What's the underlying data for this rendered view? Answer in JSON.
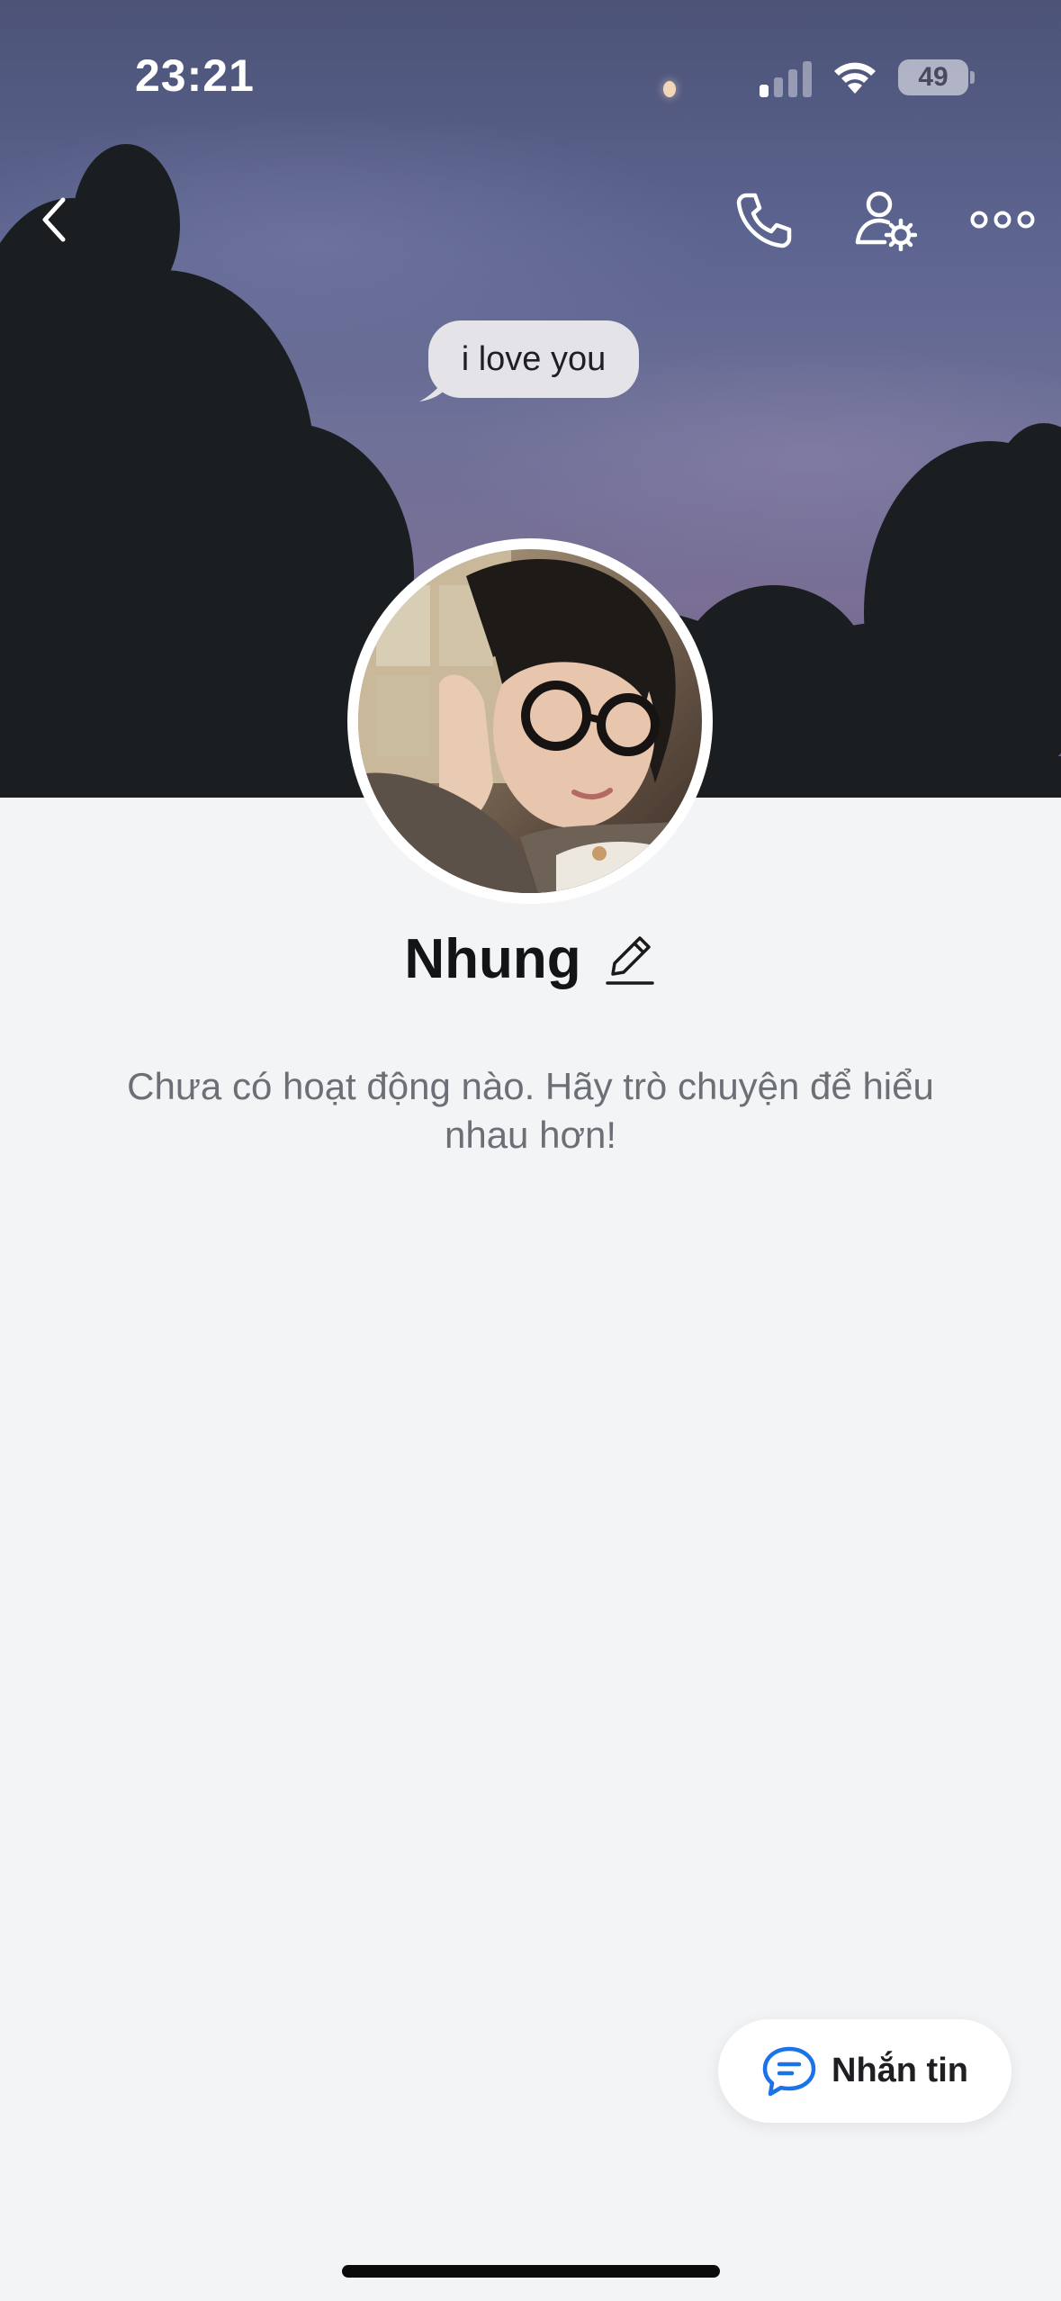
{
  "status_bar": {
    "time": "23:21",
    "battery": "49"
  },
  "cover": {
    "bubble_text": "i love you"
  },
  "toolbar": {
    "back_icon": "chevron-left-icon",
    "call_icon": "phone-icon",
    "settings_icon": "user-settings-icon",
    "more_icon": "more-horizontal-icon"
  },
  "profile": {
    "name": "Nhung",
    "edit_icon": "pencil-icon",
    "empty_message": "Chưa có hoạt động nào. Hãy trò chuyện để hiểu nhau hơn!"
  },
  "message_button": {
    "label": "Nhắn tin",
    "icon": "chat-bubble-icon",
    "accent_color": "#1a73e8"
  }
}
